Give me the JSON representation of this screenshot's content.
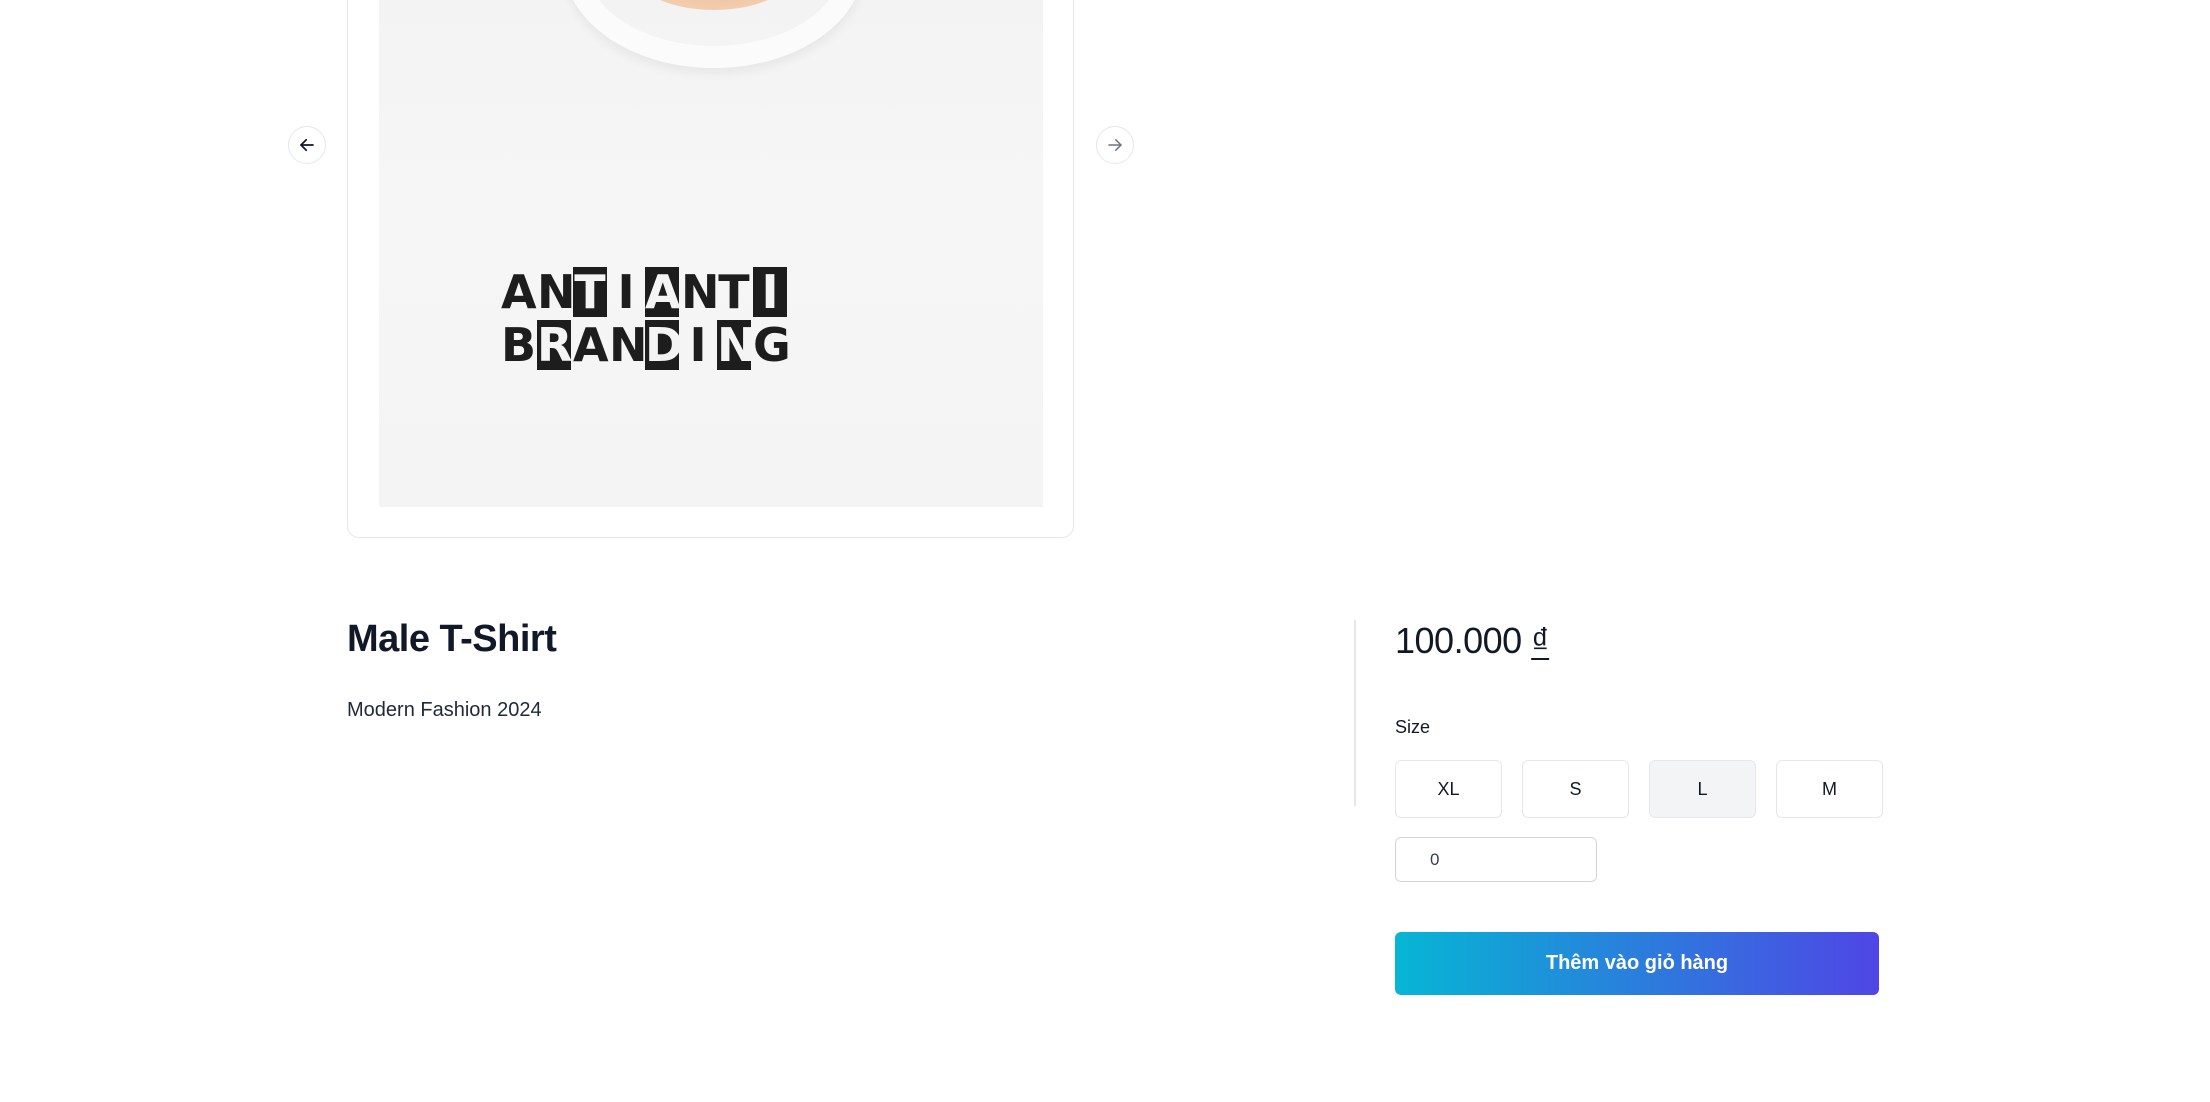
{
  "carousel": {
    "image_print_lines": [
      [
        "A",
        "N",
        "T",
        "I",
        "A",
        "N",
        "T",
        "I"
      ],
      [
        "B",
        "R",
        "A",
        "N",
        "D",
        "I",
        "N",
        "G"
      ]
    ],
    "print_inverted_cells": [
      [
        false,
        false,
        true,
        false,
        true,
        false,
        false,
        true
      ],
      [
        false,
        true,
        false,
        false,
        true,
        false,
        true,
        false
      ]
    ],
    "prev_icon": "arrow-left-icon",
    "next_icon": "arrow-right-icon"
  },
  "product": {
    "title": "Male T-Shirt",
    "description": "Modern Fashion 2024",
    "price_amount": "100.000",
    "price_currency": "₫"
  },
  "size": {
    "label": "Size",
    "options": [
      "XL",
      "S",
      "L",
      "M"
    ],
    "selected": "L"
  },
  "quantity": {
    "value": "0"
  },
  "cart": {
    "add_label": "Thêm vào giỏ hàng",
    "gradient_start": "#06b6d4",
    "gradient_end": "#4f46e5"
  }
}
